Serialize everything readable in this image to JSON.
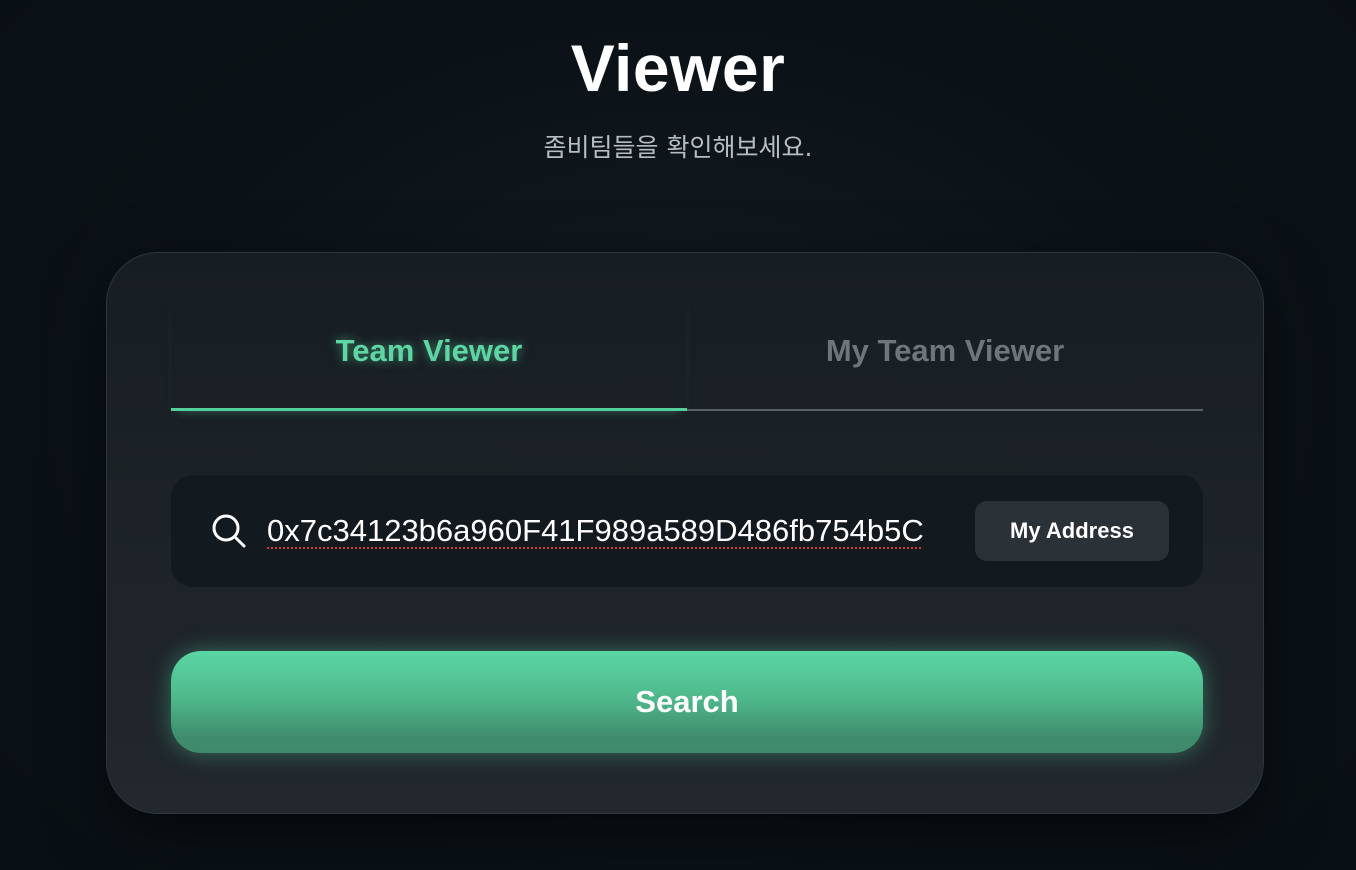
{
  "header": {
    "title": "Viewer",
    "subtitle": "좀비팀들을 확인해보세요."
  },
  "tabs": [
    {
      "label": "Team Viewer",
      "active": true
    },
    {
      "label": "My Team Viewer",
      "active": false
    }
  ],
  "search": {
    "value": "0x7c34123b6a960F41F989a589D486fb754b5C",
    "icon": "search-icon",
    "my_address_label": "My Address"
  },
  "actions": {
    "search_label": "Search"
  },
  "colors": {
    "accent": "#5dd6a4",
    "background": "#0b1116",
    "card": "#1d2328"
  }
}
